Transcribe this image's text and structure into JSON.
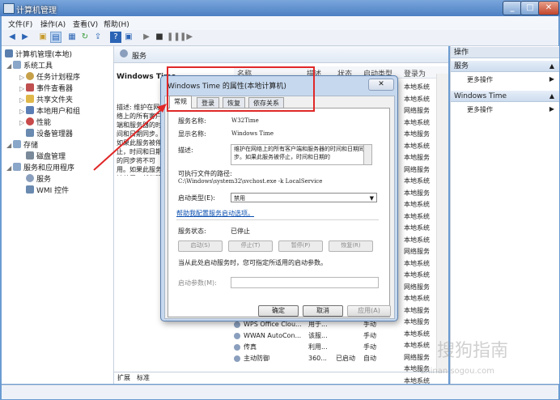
{
  "window": {
    "title": "计算机管理",
    "min": "_",
    "max": "□",
    "close": "✕"
  },
  "menu": [
    "文件(F)",
    "操作(A)",
    "查看(V)",
    "帮助(H)"
  ],
  "tree": [
    {
      "label": "计算机管理(本地)",
      "depth": 0,
      "color": "#5a7fae"
    },
    {
      "label": "系统工具",
      "depth": 1,
      "color": "#8aa6c8"
    },
    {
      "label": "任务计划程序",
      "depth": 2,
      "color": "#c7a14a"
    },
    {
      "label": "事件查看器",
      "depth": 2,
      "color": "#c05050"
    },
    {
      "label": "共享文件夹",
      "depth": 2,
      "color": "#e0b84a"
    },
    {
      "label": "本地用户和组",
      "depth": 2,
      "color": "#5b7fb5"
    },
    {
      "label": "性能",
      "depth": 2,
      "color": "#c84a4a"
    },
    {
      "label": "设备管理器",
      "depth": 2,
      "color": "#6a8ab0"
    },
    {
      "label": "存储",
      "depth": 1,
      "color": "#8aa6c8"
    },
    {
      "label": "磁盘管理",
      "depth": 2,
      "color": "#7a8a9a"
    },
    {
      "label": "服务和应用程序",
      "depth": 1,
      "color": "#8aa6c8"
    },
    {
      "label": "服务",
      "depth": 2,
      "color": "#8a9fbd"
    },
    {
      "label": "WMI 控件",
      "depth": 2,
      "color": "#6a8ab0"
    }
  ],
  "middle": {
    "header": "服务",
    "detail_title": "Windows Time",
    "detail_desc": "描述:\n维护在网络上的所有客户端和服务器的时间和日期同步。如果此服务被停止，时间和日期的同步将不可用。如果此服务被禁用，任何明确依赖它的服务都将不能启动。",
    "columns": [
      "名称",
      "描述",
      "状态",
      "启动类型",
      "登录为"
    ],
    "logon_values": [
      "本地系统",
      "本地系统",
      "网络服务",
      "本地系统",
      "本地服务",
      "本地系统",
      "本地服务",
      "网络服务",
      "本地系统",
      "本地服务",
      "本地系统",
      "本地系统",
      "本地系统",
      "本地系统",
      "网络服务",
      "本地系统",
      "本地系统",
      "网络服务",
      "本地系统",
      "本地服务",
      "本地服务",
      "本地系统",
      "本地系统",
      "网络服务",
      "本地服务",
      "本地系统"
    ],
    "rows": [
      {
        "name": "WPS Office Clou...",
        "desc": "用于...",
        "status": "",
        "startup": "手动",
        "logon": "本地系统"
      },
      {
        "name": "WWAN AutoCon...",
        "desc": "该服...",
        "status": "",
        "startup": "手动",
        "logon": "本地服务"
      },
      {
        "name": "传真",
        "desc": "利用...",
        "status": "",
        "startup": "手动",
        "logon": "网络服务"
      },
      {
        "name": "主动防御",
        "desc": "360...",
        "status": "已启动",
        "startup": "自动",
        "logon": "本地系统"
      }
    ],
    "tabs": [
      "扩展",
      "标准"
    ]
  },
  "actions": {
    "header": "操作",
    "section1": "服务",
    "item1": "更多操作",
    "section2": "Windows Time",
    "item2": "更多操作"
  },
  "dialog": {
    "title": "Windows Time 的属性(本地计算机)",
    "close": "✕",
    "tabs": [
      "常规",
      "登录",
      "恢复",
      "依存关系"
    ],
    "service_name_label": "服务名称:",
    "service_name": "W32Time",
    "display_name_label": "显示名称:",
    "display_name": "Windows Time",
    "desc_label": "描述:",
    "desc": "维护在网络上的所有客户端和服务器的时间和日期同步。如果此服务被停止，时间和日期的",
    "path_label": "可执行文件的路径:",
    "path": "C:\\Windows\\system32\\svchost.exe -k LocalService",
    "startup_label": "启动类型(E):",
    "startup_value": "禁用",
    "help_link": "帮助我配置服务启动选项。",
    "status_label": "服务状态:",
    "status_value": "已停止",
    "buttons": [
      "启动(S)",
      "停止(T)",
      "暂停(P)",
      "恢复(R)"
    ],
    "hint": "当从此处启动服务时，您可指定所适用的启动参数。",
    "param_label": "启动参数(M):",
    "ok": "确定",
    "cancel": "取消",
    "apply": "应用(A)"
  },
  "watermark": {
    "main": "搜狗指南",
    "sub": "zhinan.sogou.com"
  },
  "colors": {
    "annotation": "#e02828",
    "link": "#0b4fb0"
  }
}
